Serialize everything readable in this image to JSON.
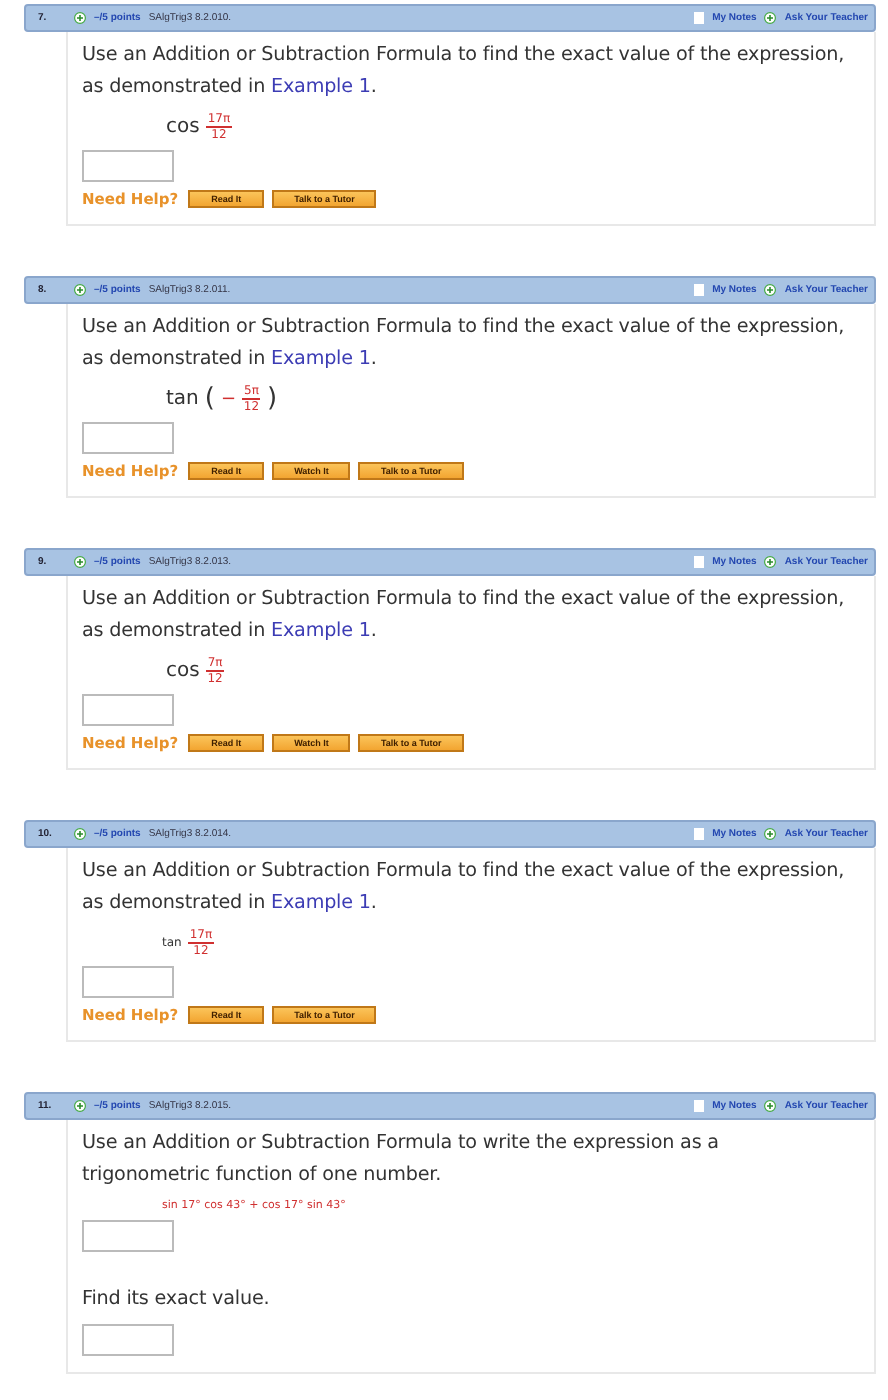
{
  "questions": [
    {
      "number": "7.",
      "points": "–/5 points",
      "code": "SAlgTrig3 8.2.010.",
      "notes": "My Notes",
      "ask": "Ask Your Teacher",
      "blocks": [
        {
          "kind": "prompt",
          "text": "Use an Addition or Subtraction Formula to find the exact value of the expression, as demonstrated in ",
          "link": "Example 1",
          "after": "."
        },
        {
          "kind": "fraction",
          "func": "cos",
          "numerator": "17π",
          "denominator": "12"
        },
        {
          "kind": "input"
        },
        {
          "kind": "help",
          "label": "Need Help?",
          "buttons": [
            "Read It",
            "Talk to a Tutor"
          ]
        }
      ]
    },
    {
      "number": "8.",
      "points": "–/5 points",
      "code": "SAlgTrig3 8.2.011.",
      "notes": "My Notes",
      "ask": "Ask Your Teacher",
      "blocks": [
        {
          "kind": "prompt",
          "text": "Use an Addition or Subtraction Formula to find the exact value of the expression, as demonstrated in ",
          "link": "Example 1",
          "after": "."
        },
        {
          "kind": "fraction",
          "func": "tan",
          "open": "(",
          "sign": "−",
          "numerator": "5π",
          "denominator": "12",
          "close": ")"
        },
        {
          "kind": "input"
        },
        {
          "kind": "help",
          "label": "Need Help?",
          "buttons": [
            "Read It",
            "Watch It",
            "Talk to a Tutor"
          ]
        }
      ]
    },
    {
      "number": "9.",
      "points": "–/5 points",
      "code": "SAlgTrig3 8.2.013.",
      "notes": "My Notes",
      "ask": "Ask Your Teacher",
      "blocks": [
        {
          "kind": "prompt",
          "text": "Use an Addition or Subtraction Formula to find the exact value of the expression, as demonstrated in ",
          "link": "Example 1",
          "after": "."
        },
        {
          "kind": "fraction",
          "func": "cos",
          "numerator": "7π",
          "denominator": "12"
        },
        {
          "kind": "input"
        },
        {
          "kind": "help",
          "label": "Need Help?",
          "buttons": [
            "Read It",
            "Watch It",
            "Talk to a Tutor"
          ]
        }
      ]
    },
    {
      "number": "10.",
      "points": "–/5 points",
      "code": "SAlgTrig3 8.2.014.",
      "notes": "My Notes",
      "ask": "Ask Your Teacher",
      "blocks": [
        {
          "kind": "prompt",
          "text": "Use an Addition or Subtraction Formula to find the exact value of the expression, as demonstrated in ",
          "link": "Example 1",
          "after": "."
        },
        {
          "kind": "fraction",
          "small": true,
          "func": "tan",
          "numerator": "17π",
          "denominator": "12"
        },
        {
          "kind": "input"
        },
        {
          "kind": "help",
          "label": "Need Help?",
          "buttons": [
            "Read It",
            "Talk to a Tutor"
          ]
        }
      ]
    },
    {
      "number": "11.",
      "points": "–/5 points",
      "code": "SAlgTrig3 8.2.015.",
      "notes": "My Notes",
      "ask": "Ask Your Teacher",
      "blocks": [
        {
          "kind": "prompt",
          "text": "Use an Addition or Subtraction Formula to write the expression as a trigonometric function of one number."
        },
        {
          "kind": "expression",
          "text": "sin 17° cos 43° + cos 17° sin 43°"
        },
        {
          "kind": "input"
        },
        {
          "kind": "prompt",
          "text": "Find its exact value."
        },
        {
          "kind": "input"
        }
      ]
    }
  ]
}
